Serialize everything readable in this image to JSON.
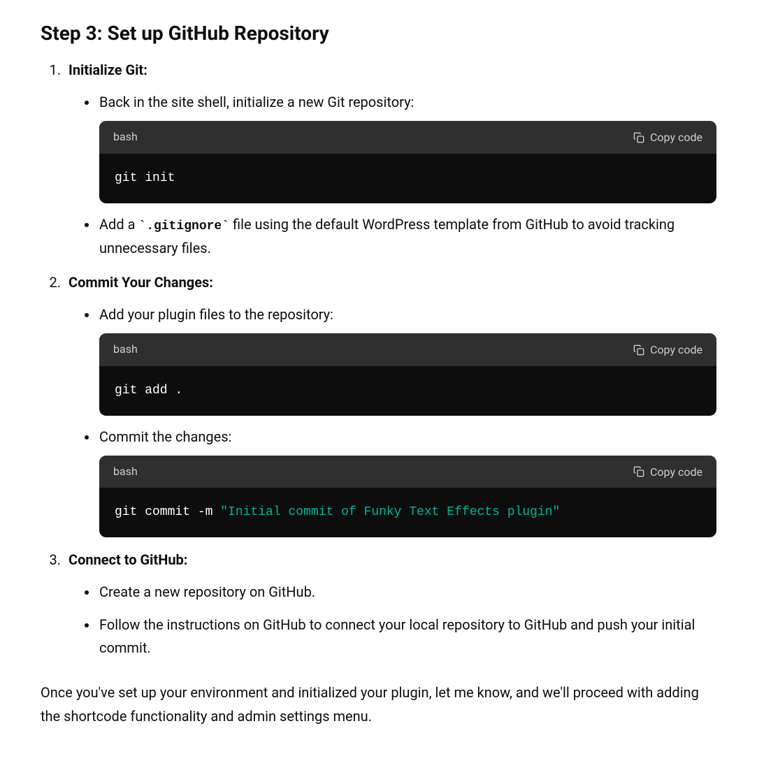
{
  "heading": "Step 3: Set up GitHub Repository",
  "copy_label": "Copy code",
  "lang_label": "bash",
  "items": [
    {
      "title": "Initialize Git:",
      "bullets": [
        {
          "text": "Back in the site shell, initialize a new Git repository:",
          "code": {
            "plain": "git init"
          }
        },
        {
          "text_pre": "Add a ",
          "code_inline": "`.gitignore`",
          "text_post": " file using the default WordPress template from GitHub to avoid tracking unnecessary files."
        }
      ]
    },
    {
      "title": "Commit Your Changes:",
      "bullets": [
        {
          "text": "Add your plugin files to the repository:",
          "code": {
            "plain": "git add ."
          }
        },
        {
          "text": "Commit the changes:",
          "code": {
            "plain_prefix": "git commit -m ",
            "string_part": "\"Initial commit of Funky Text Effects plugin\"",
            "trailing_blank": true
          }
        }
      ]
    },
    {
      "title": "Connect to GitHub:",
      "bullets": [
        {
          "text": "Create a new repository on GitHub."
        },
        {
          "text": "Follow the instructions on GitHub to connect your local repository to GitHub and push your initial commit."
        }
      ]
    }
  ],
  "closing": "Once you've set up your environment and initialized your plugin, let me know, and we'll proceed with adding the shortcode functionality and admin settings menu."
}
